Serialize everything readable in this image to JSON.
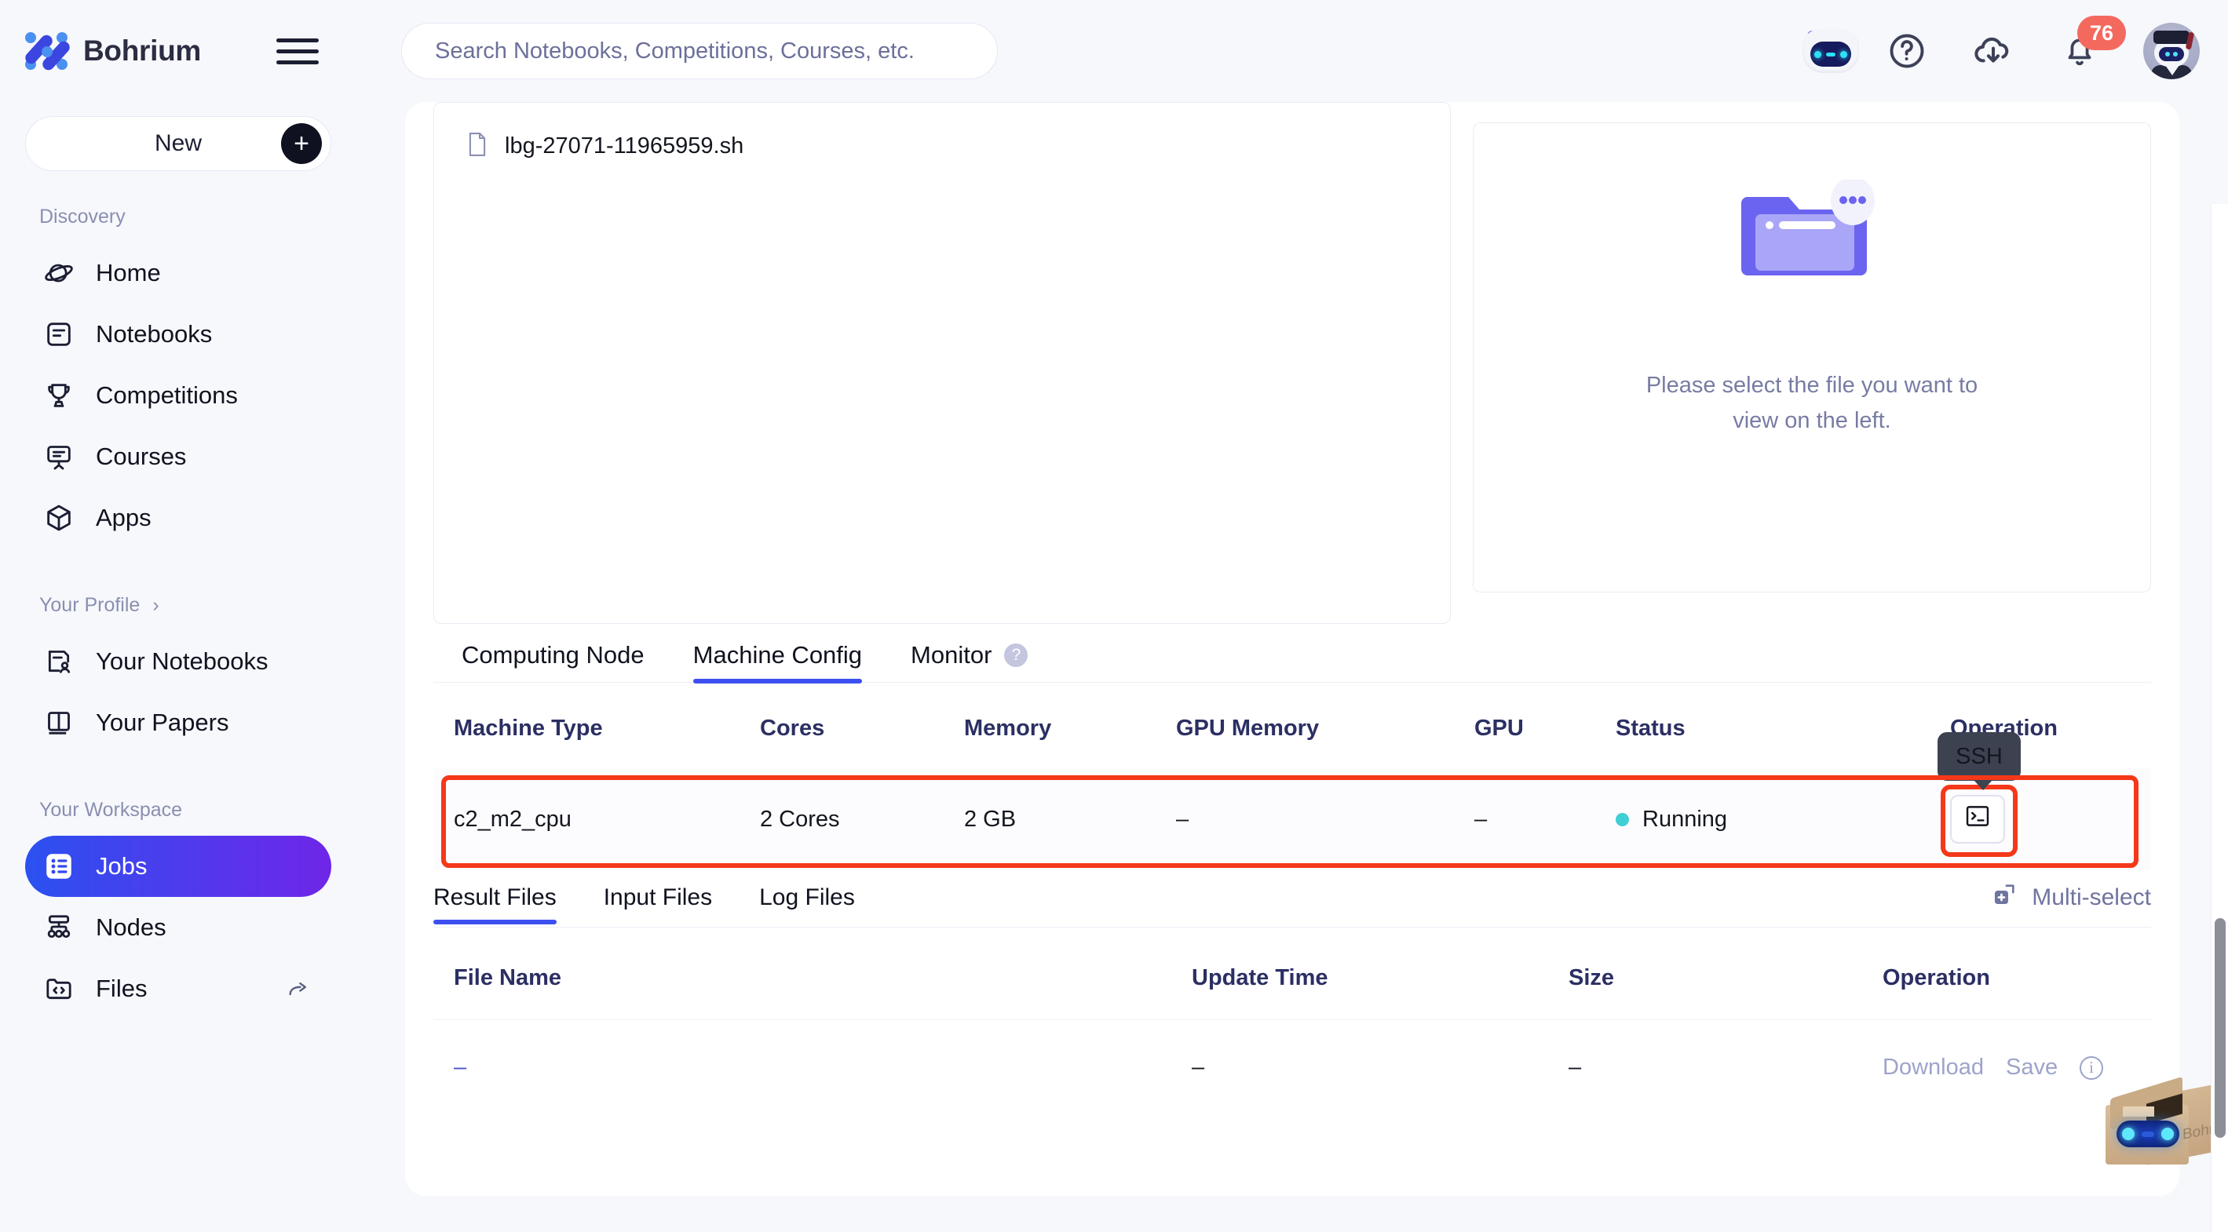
{
  "brand": {
    "name": "Bohrium",
    "logo_icon": "bohrium-logo-icon",
    "menu_icon": "hamburger-menu-icon"
  },
  "search": {
    "placeholder": "Search Notebooks, Competitions, Courses, etc.",
    "value": ""
  },
  "topbar": {
    "assistant_icon": "ai-robot-icon",
    "help_icon": "question-circle-icon",
    "download_icon": "cloud-download-icon",
    "notifications_icon": "bell-icon",
    "notifications_count": "76",
    "avatar_icon": "user-avatar-icon"
  },
  "sidebar": {
    "new_button": {
      "label": "New",
      "icon": "plus-icon"
    },
    "sections": [
      {
        "title": "Discovery",
        "items": [
          {
            "label": "Home",
            "icon": "planet-icon",
            "active": false
          },
          {
            "label": "Notebooks",
            "icon": "notebook-icon",
            "active": false
          },
          {
            "label": "Competitions",
            "icon": "trophy-icon",
            "active": false
          },
          {
            "label": "Courses",
            "icon": "presentation-board-icon",
            "active": false
          },
          {
            "label": "Apps",
            "icon": "cube-icon",
            "active": false
          }
        ]
      },
      {
        "title": "Your Profile",
        "chevron": "›",
        "items": [
          {
            "label": "Your Notebooks",
            "icon": "notebook-user-icon",
            "active": false
          },
          {
            "label": "Your Papers",
            "icon": "book-icon",
            "active": false
          }
        ]
      },
      {
        "title": "Your Workspace",
        "items": [
          {
            "label": "Jobs",
            "icon": "list-icon",
            "active": true
          },
          {
            "label": "Nodes",
            "icon": "nodes-network-icon",
            "active": false
          },
          {
            "label": "Files",
            "icon": "code-folder-icon",
            "active": false,
            "trailing_icon": "share-arrow-icon"
          }
        ]
      }
    ]
  },
  "file_browser": {
    "file_item": {
      "name": "lbg-27071-11965959.sh",
      "icon": "file-icon"
    },
    "preview_empty": {
      "illustration_icon": "folder-ellipsis-icon",
      "line1": "Please select the file you want to",
      "line2": "view on the left."
    }
  },
  "detail_tabs": [
    {
      "label": "Computing Node",
      "active": false
    },
    {
      "label": "Machine Config",
      "active": true
    },
    {
      "label": "Monitor",
      "active": false,
      "help_icon": "question-mark-icon"
    }
  ],
  "machine_config": {
    "columns": [
      "Machine Type",
      "Cores",
      "Memory",
      "GPU Memory",
      "GPU",
      "Status",
      "Operation"
    ],
    "rows": [
      {
        "machine_type": "c2_m2_cpu",
        "cores": "2 Cores",
        "memory": "2 GB",
        "gpu_memory": "–",
        "gpu": "–",
        "status": "Running",
        "status_color": "#3fcfd4",
        "operation_icon": "terminal-icon"
      }
    ],
    "tooltip": "SSH",
    "highlight_color": "#f5381a"
  },
  "file_tabs": [
    {
      "label": "Result Files",
      "active": true
    },
    {
      "label": "Input Files",
      "active": false
    },
    {
      "label": "Log Files",
      "active": false
    }
  ],
  "multi_select": {
    "label": "Multi-select",
    "icon": "multi-select-icon"
  },
  "file_table": {
    "columns": [
      "File Name",
      "Update Time",
      "Size",
      "Operation"
    ],
    "rows": [
      {
        "file_name": "–",
        "update_time": "–",
        "size": "–",
        "operations": {
          "download": "Download",
          "save": "Save",
          "info_icon": "info-circle-icon"
        }
      }
    ]
  },
  "mascot": {
    "label": "Bohr",
    "icon": "bohr-box-mascot-icon"
  },
  "colors": {
    "accent": "#3d4ff0",
    "active_gradient_start": "#2b51f0",
    "active_gradient_end": "#6f26e8",
    "status_running": "#3fcfd4",
    "highlight_red": "#f5381a",
    "badge_red": "#f4695e",
    "page_bg": "#f7f8fc"
  }
}
